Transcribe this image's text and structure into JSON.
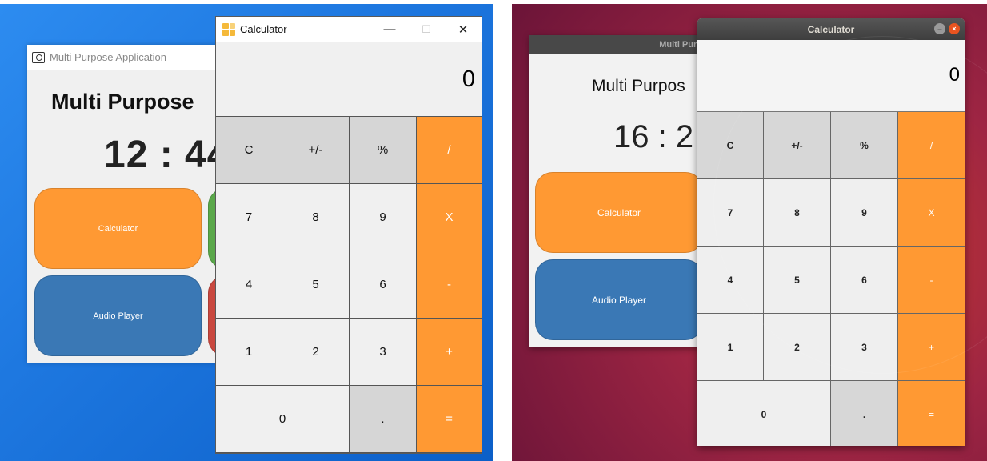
{
  "windows": {
    "main_app": {
      "title": "Multi Purpose Application",
      "heading": "Multi Purpose",
      "clock": "12 : 44",
      "tiles": {
        "calculator": "Calculator",
        "audio_player": "Audio Player"
      }
    },
    "calculator": {
      "title": "Calculator",
      "controls": {
        "minimize": "—",
        "maximize": "☐",
        "close": "✕"
      },
      "display": "0"
    }
  },
  "ubuntu": {
    "main_app": {
      "title": "Multi Purp",
      "heading": "Multi Purpos",
      "clock": "16 : 2",
      "tiles": {
        "calculator": "Calculator",
        "audio_player": "Audio Player"
      }
    },
    "calculator": {
      "title": "Calculator",
      "display": "0"
    }
  },
  "keypad": {
    "clear": "C",
    "sign": "+/-",
    "percent": "%",
    "divide": "/",
    "seven": "7",
    "eight": "8",
    "nine": "9",
    "multiply": "X",
    "four": "4",
    "five": "5",
    "six": "6",
    "subtract": "-",
    "one": "1",
    "two": "2",
    "three": "3",
    "add": "+",
    "zero": "0",
    "decimal": ".",
    "equals": "="
  },
  "colors": {
    "operator_orange": "#ff9933",
    "function_gray": "#d6d6d6",
    "tile_blue": "#3a78b5",
    "ubuntu_close": "#e95420"
  }
}
